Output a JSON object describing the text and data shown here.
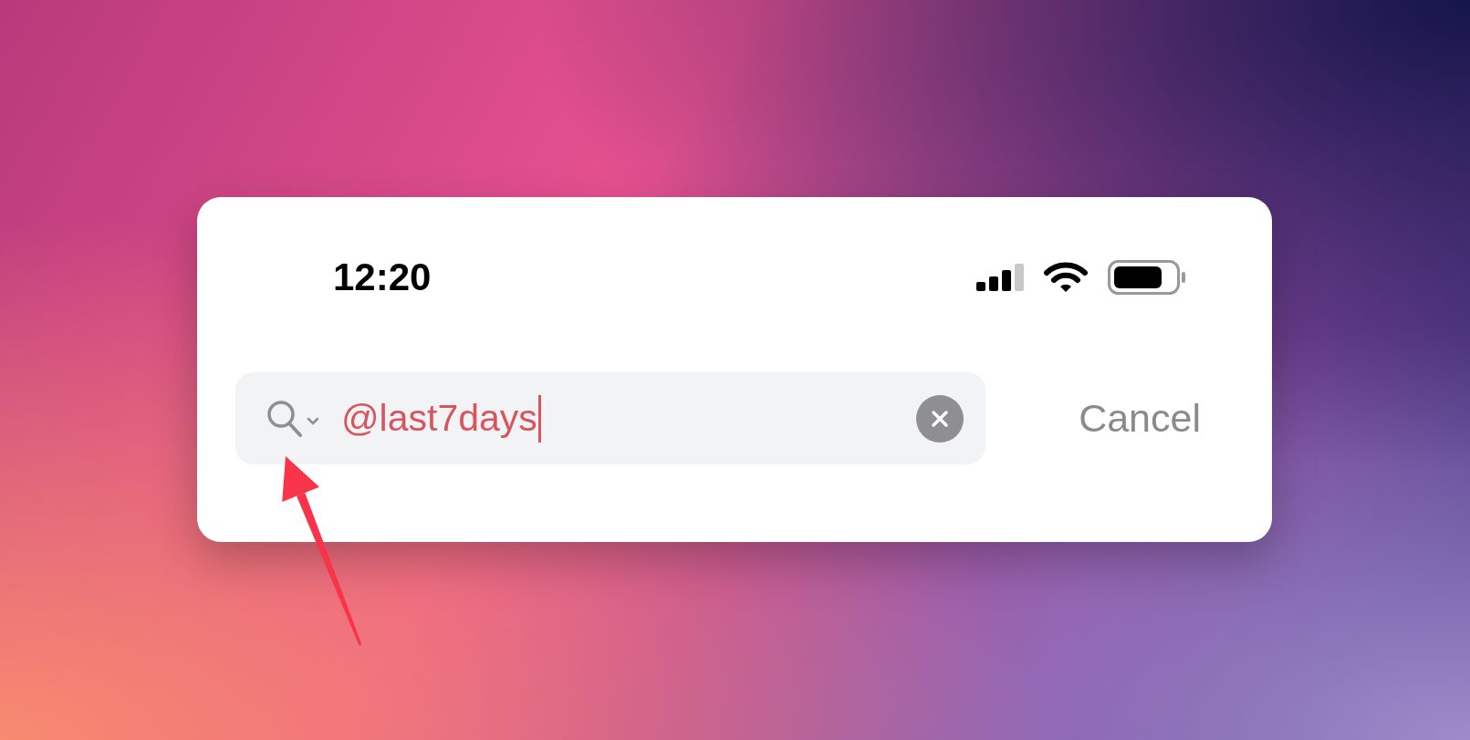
{
  "status_bar": {
    "time": "12:20"
  },
  "search": {
    "value": "@last7days",
    "focused": true
  },
  "cancel_button": {
    "label": "Cancel"
  }
}
